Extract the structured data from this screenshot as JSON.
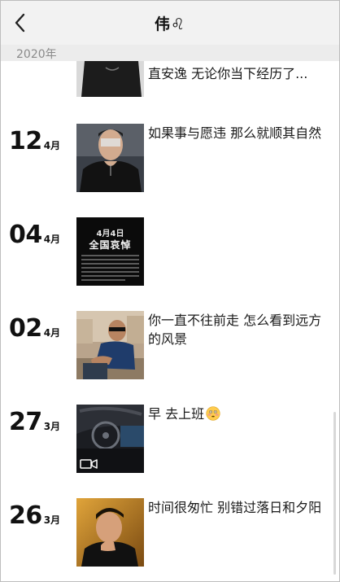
{
  "nav": {
    "title": "伟♌︎",
    "back_icon": "chevron-left-icon"
  },
  "year_label": "2020年",
  "entries": [
    {
      "day": "",
      "month": "",
      "text": "直安逸 无论你当下经历了...",
      "thumb": "man-black-tank-top-photo"
    },
    {
      "day": "12",
      "month": "4月",
      "text": "如果事与愿违 那么就顺其自然",
      "thumb": "man-selfie-black-shirt-photo"
    },
    {
      "day": "04",
      "month": "4月",
      "text": "",
      "thumb": "mourning-day-poster",
      "poster": {
        "date": "4月4日",
        "heading": "全国哀悼"
      }
    },
    {
      "day": "02",
      "month": "4月",
      "text": "你一直不往前走 怎么看到远方的风景",
      "thumb": "man-sunglasses-outdoor-photo"
    },
    {
      "day": "27",
      "month": "3月",
      "text": "早 去上班",
      "thumb": "car-dashboard-video",
      "emoji": "flushed-face-emoji"
    },
    {
      "day": "26",
      "month": "3月",
      "text": "时间很匆忙 别错过落日和夕阳",
      "thumb": "man-hand-on-chin-photo"
    }
  ]
}
